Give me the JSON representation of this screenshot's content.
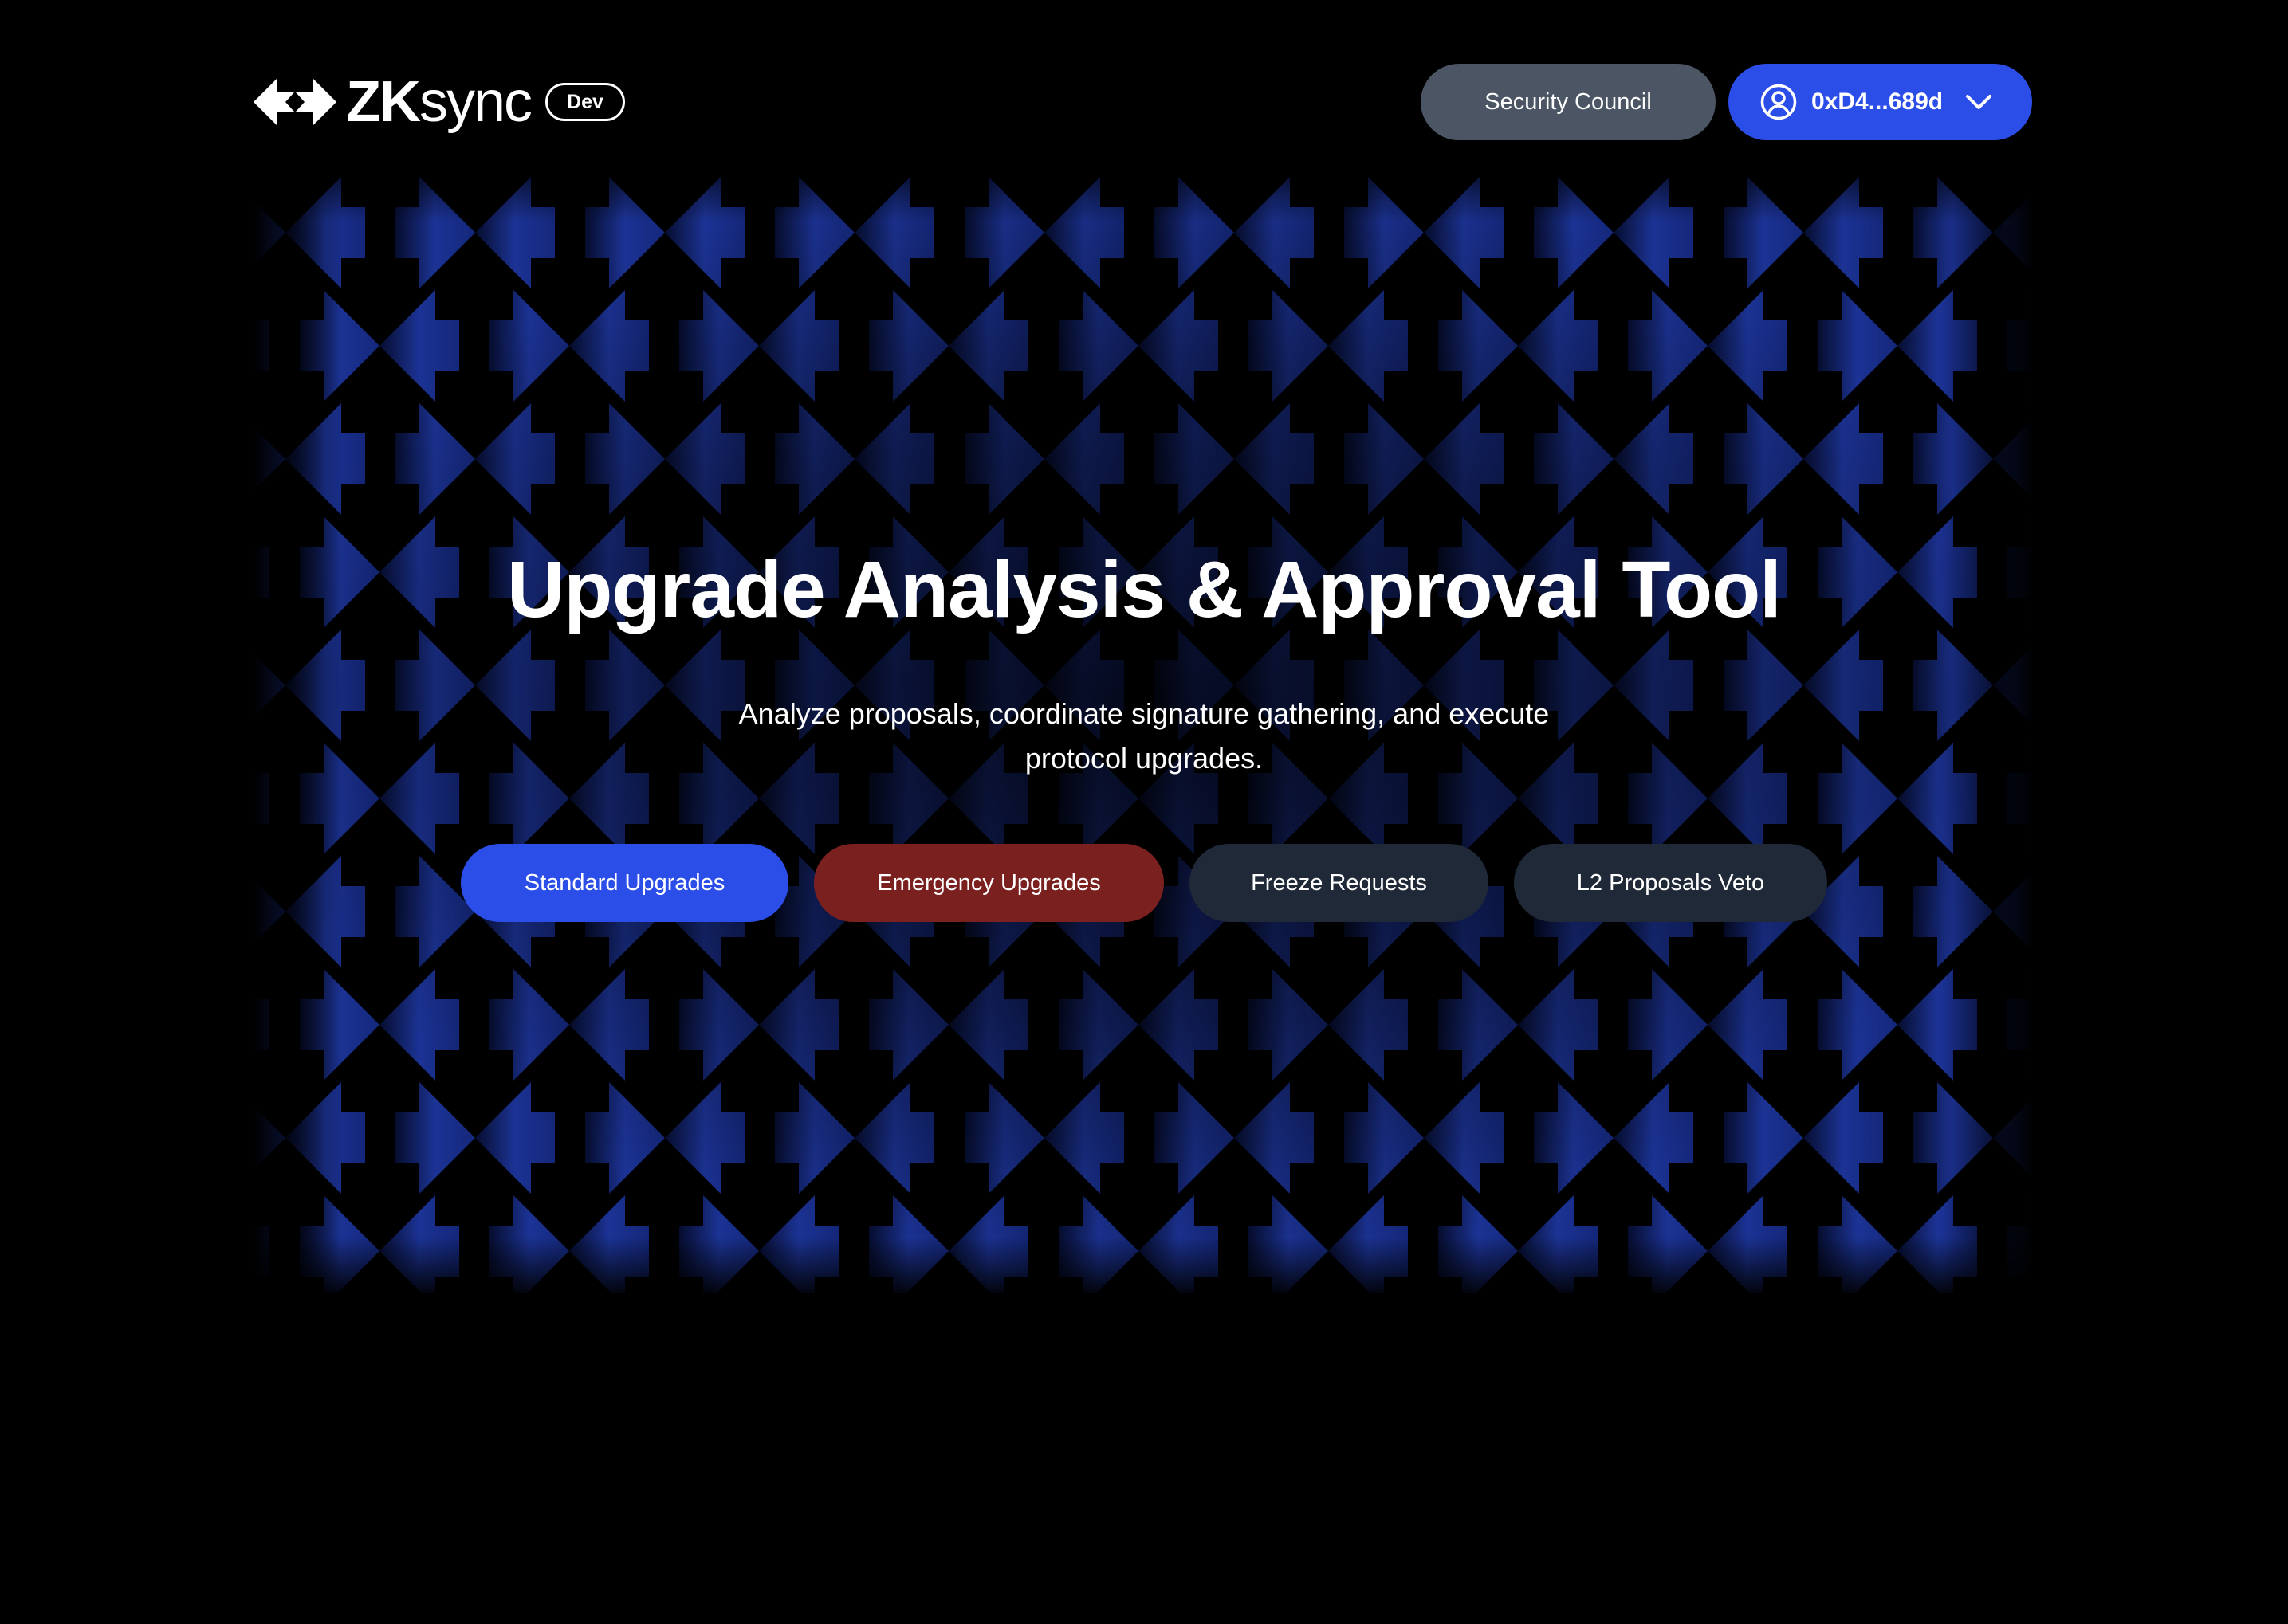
{
  "header": {
    "logo_text_bold": "ZK",
    "logo_text_regular": "sync",
    "env_badge": "Dev",
    "security_council_label": "Security Council",
    "wallet": {
      "address": "0xD4...689d",
      "icon": "user-circle-icon",
      "dropdown_icon": "chevron-down-icon"
    }
  },
  "hero": {
    "title": "Upgrade Analysis & Approval Tool",
    "subtitle": "Analyze proposals, coordinate signature gathering, and execute protocol upgrades.",
    "actions": [
      {
        "label": "Standard Upgrades",
        "color": "#2c4ee8"
      },
      {
        "label": "Emergency Upgrades",
        "color": "#7a2120"
      },
      {
        "label": "Freeze Requests",
        "color": "#1f2937"
      },
      {
        "label": "L2 Proposals Veto",
        "color": "#1f2937"
      }
    ]
  },
  "theme": {
    "background": "#000000",
    "accent": "#2c4ee8",
    "pattern_color": "#1a2f8f",
    "pattern_icon": "zksync-arrows-icon"
  }
}
